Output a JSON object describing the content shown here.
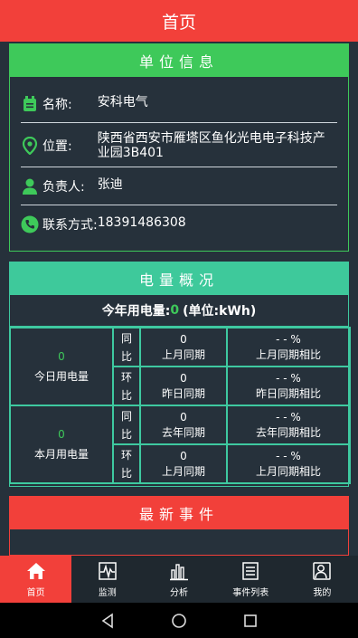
{
  "header": {
    "title": "首页"
  },
  "unit_info": {
    "title": "单位信息",
    "name_label": "名称:",
    "name_value": "安科电气",
    "location_label": "位置:",
    "location_value": "陕西省西安市雁塔区鱼化光电电子科技产业园3B401",
    "manager_label": "负责人:",
    "manager_value": "张迪",
    "contact_label": "联系方式:",
    "contact_value": "18391486308"
  },
  "power": {
    "title": "电量概况",
    "year_label": "今年用电量:",
    "year_value": "0",
    "year_unit": "(单位:kWh)",
    "today": {
      "value": "0",
      "label": "今日用电量",
      "yoy_label": "同比",
      "yoy_value": "0",
      "yoy_period": "上月同期",
      "yoy_pct": "- - %",
      "yoy_pct_label": "上月同期相比",
      "mom_label": "环比",
      "mom_value": "0",
      "mom_period": "昨日同期",
      "mom_pct": "- - %",
      "mom_pct_label": "昨日同期相比"
    },
    "month": {
      "value": "0",
      "label": "本月用电量",
      "yoy_label": "同比",
      "yoy_value": "0",
      "yoy_period": "去年同期",
      "yoy_pct": "- - %",
      "yoy_pct_label": "去年同期相比",
      "mom_label": "环比",
      "mom_value": "0",
      "mom_period": "上月同期",
      "mom_pct": "- - %",
      "mom_pct_label": "上月同期相比"
    }
  },
  "events": {
    "title": "最新事件"
  },
  "nav": {
    "items": [
      {
        "label": "首页",
        "icon": "home-icon"
      },
      {
        "label": "监测",
        "icon": "monitor-icon"
      },
      {
        "label": "分析",
        "icon": "chart-icon"
      },
      {
        "label": "事件列表",
        "icon": "list-icon"
      },
      {
        "label": "我的",
        "icon": "profile-icon"
      }
    ]
  },
  "colors": {
    "accent_red": "#f2403a",
    "accent_green": "#3ec95a",
    "teal": "#3ec99b",
    "background": "#26313b"
  }
}
